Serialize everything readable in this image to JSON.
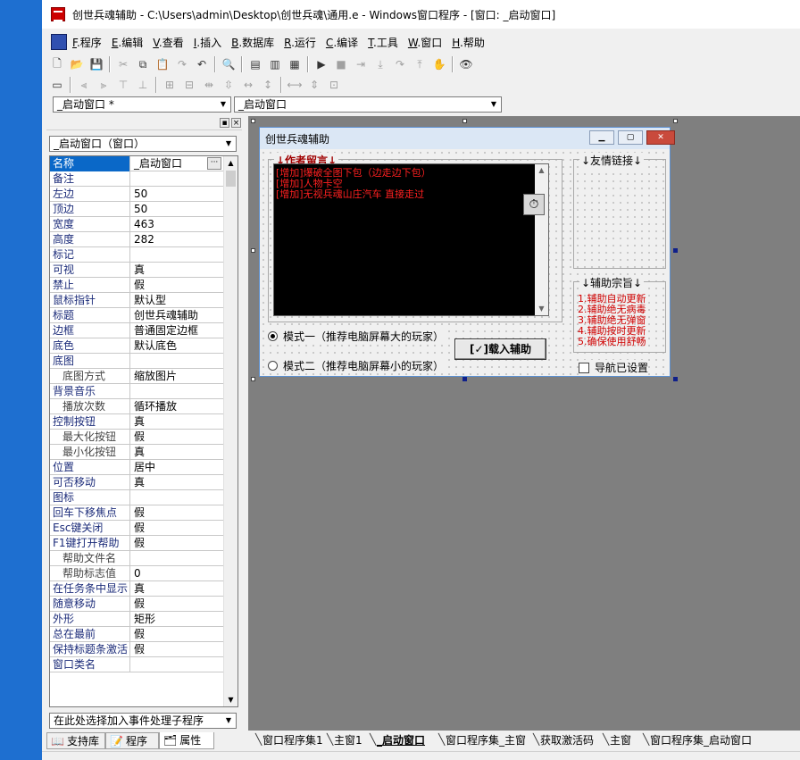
{
  "window": {
    "title": "创世兵魂辅助 - C:\\Users\\admin\\Desktop\\创世兵魂\\通用.e - Windows窗口程序 - [窗口: _启动窗口]"
  },
  "menu": [
    {
      "key": "F",
      "label": ".程序"
    },
    {
      "key": "E",
      "label": ".编辑"
    },
    {
      "key": "V",
      "label": ".查看"
    },
    {
      "key": "I",
      "label": ".插入"
    },
    {
      "key": "B",
      "label": ".数据库"
    },
    {
      "key": "R",
      "label": ".运行"
    },
    {
      "key": "C",
      "label": ".编译"
    },
    {
      "key": "T",
      "label": ".工具"
    },
    {
      "key": "W",
      "label": ".窗口"
    },
    {
      "key": "H",
      "label": ".帮助"
    }
  ],
  "toolbar1_icons": [
    "new-file-icon",
    "open-folder-icon",
    "save-icon",
    "sep",
    "cut-icon",
    "copy-icon",
    "paste-icon",
    "redo-icon",
    "undo-icon",
    "sep",
    "find-icon",
    "sep",
    "layout1-icon",
    "layout2-icon",
    "layout3-icon",
    "sep",
    "run-icon",
    "stop-icon",
    "step-icon",
    "step-into-icon",
    "step-over-icon",
    "step-out-icon",
    "hand-icon",
    "sep",
    "binoculars-icon"
  ],
  "toolbar2_icons": [
    "form-icon",
    "sep",
    "align-left-icon",
    "align-right-icon",
    "align-top-icon",
    "align-bottom-icon",
    "sep",
    "center-h-icon",
    "center-v-icon",
    "distribute-h-icon",
    "distribute-v-icon",
    "space-h-icon",
    "space-v-icon",
    "sep",
    "same-width-icon",
    "same-height-icon",
    "same-size-icon"
  ],
  "combos": {
    "left": "_启动窗口 *",
    "right": "_启动窗口",
    "object": "_启动窗口（窗口）",
    "event": "在此处选择加入事件处理子程序"
  },
  "properties": [
    {
      "name": "名称",
      "value": "_启动窗口",
      "selected": true,
      "dots": true
    },
    {
      "name": "备注",
      "value": ""
    },
    {
      "name": "左边",
      "value": "50"
    },
    {
      "name": "顶边",
      "value": "50"
    },
    {
      "name": "宽度",
      "value": "463"
    },
    {
      "name": "高度",
      "value": "282"
    },
    {
      "name": "标记",
      "value": ""
    },
    {
      "name": "可视",
      "value": "真"
    },
    {
      "name": "禁止",
      "value": "假"
    },
    {
      "name": "鼠标指针",
      "value": "默认型"
    },
    {
      "name": "标题",
      "value": "创世兵魂辅助"
    },
    {
      "name": "边框",
      "value": "普通固定边框"
    },
    {
      "name": "底色",
      "value": "默认底色"
    },
    {
      "name": "底图",
      "value": ""
    },
    {
      "name": "底图方式",
      "value": "缩放图片",
      "indent": true
    },
    {
      "name": "背景音乐",
      "value": ""
    },
    {
      "name": "播放次数",
      "value": "循环播放",
      "indent": true
    },
    {
      "name": "控制按钮",
      "value": "真"
    },
    {
      "name": "最大化按钮",
      "value": "假",
      "indent": true
    },
    {
      "name": "最小化按钮",
      "value": "真",
      "indent": true
    },
    {
      "name": "位置",
      "value": "居中"
    },
    {
      "name": "可否移动",
      "value": "真"
    },
    {
      "name": "图标",
      "value": ""
    },
    {
      "name": "回车下移焦点",
      "value": "假"
    },
    {
      "name": "Esc键关闭",
      "value": "假"
    },
    {
      "name": "F1键打开帮助",
      "value": "假"
    },
    {
      "name": "帮助文件名",
      "value": "",
      "indent": true
    },
    {
      "name": "帮助标志值",
      "value": "0",
      "indent": true
    },
    {
      "name": "在任务条中显示",
      "value": "真"
    },
    {
      "name": "随意移动",
      "value": "假"
    },
    {
      "name": "外形",
      "value": "矩形"
    },
    {
      "name": "总在最前",
      "value": "假"
    },
    {
      "name": "保持标题条激活",
      "value": "假"
    },
    {
      "name": "窗口类名",
      "value": ""
    }
  ],
  "panel_tabs": [
    {
      "label": "支持库",
      "icon": "book-icon"
    },
    {
      "label": "程序",
      "icon": "program-icon"
    },
    {
      "label": "属性",
      "icon": "properties-icon",
      "active": true
    }
  ],
  "form": {
    "title": "创世兵魂辅助",
    "author_group": "↓作者留言↓",
    "messages": [
      "[增加]爆破全图下包（边走边下包）",
      "[增加]人物卡空",
      "[增加]无视兵魂山庄汽车 直接走过"
    ],
    "friend_group": "↓友情链接↓",
    "purpose_group": "↓辅助宗旨↓",
    "purpose_items": [
      "1.辅助自动更新",
      "2.辅助绝无病毒",
      "3.辅助绝无弹窗",
      "4.辅助按时更新",
      "5.确保使用舒畅"
    ],
    "radio1": "模式一（推荐电脑屏幕大的玩家）",
    "radio2": "模式二（推荐电脑屏幕小的玩家）",
    "load_button": "[✓]载入辅助",
    "nav_checkbox": "导航已设置"
  },
  "doc_tabs": [
    {
      "label": "窗口程序集1"
    },
    {
      "label": "主窗1"
    },
    {
      "label": "_启动窗口",
      "active": true
    },
    {
      "label": "窗口程序集_主窗"
    },
    {
      "label": "获取激活码"
    },
    {
      "label": "主窗"
    },
    {
      "label": "窗口程序集_启动窗口"
    }
  ],
  "colors": {
    "accent": "#0a68c8",
    "workspace": "#7f7f7f",
    "message_red": "#ff2020"
  }
}
